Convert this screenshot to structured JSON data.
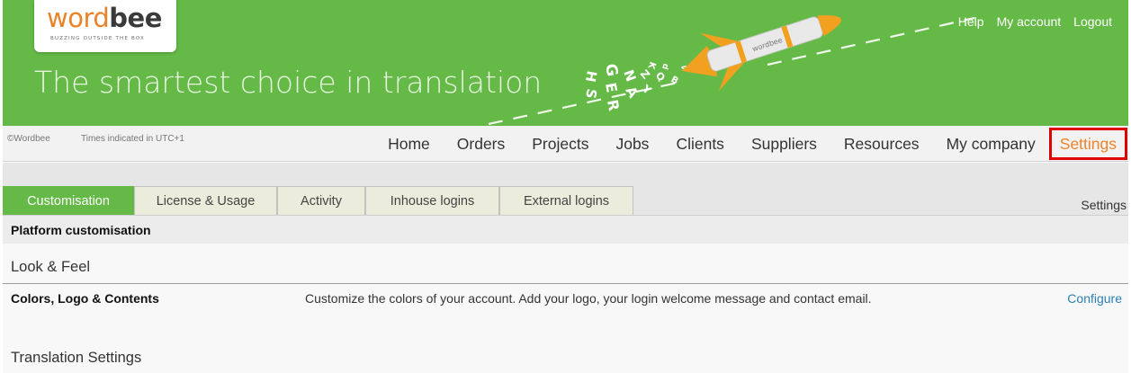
{
  "banner": {
    "logo_word_part1": "word",
    "logo_word_part2": "bee",
    "logo_tagline": "BUZZING OUTSIDE THE BOX",
    "tagline": "The smartest choice in translation",
    "top_links": [
      "Help",
      "My account",
      "Logout"
    ]
  },
  "navbar": {
    "copyright": "©Wordbee",
    "timezone": "Times indicated in UTC+1",
    "items": [
      "Home",
      "Orders",
      "Projects",
      "Jobs",
      "Clients",
      "Suppliers",
      "Resources",
      "My company",
      "Settings"
    ],
    "active": "Settings"
  },
  "tabs": [
    "Customisation",
    "License & Usage",
    "Activity",
    "Inhouse logins",
    "External logins"
  ],
  "active_tab": "Customisation",
  "breadcrumb": "Settings",
  "panel": {
    "section_title": "Platform customisation",
    "groups": [
      {
        "title": "Look & Feel",
        "rows": [
          {
            "name": "Colors, Logo & Contents",
            "description": "Customize the colors of your account. Add your logo, your login welcome message and contact email.",
            "action": "Configure"
          }
        ]
      },
      {
        "title": "Translation Settings"
      }
    ]
  },
  "colors": {
    "brand_green": "#65b947",
    "brand_orange": "#f0822a",
    "highlight_red": "#e10000",
    "link_blue": "#2a7fb8"
  },
  "icons": [
    "rocket-illustration"
  ]
}
